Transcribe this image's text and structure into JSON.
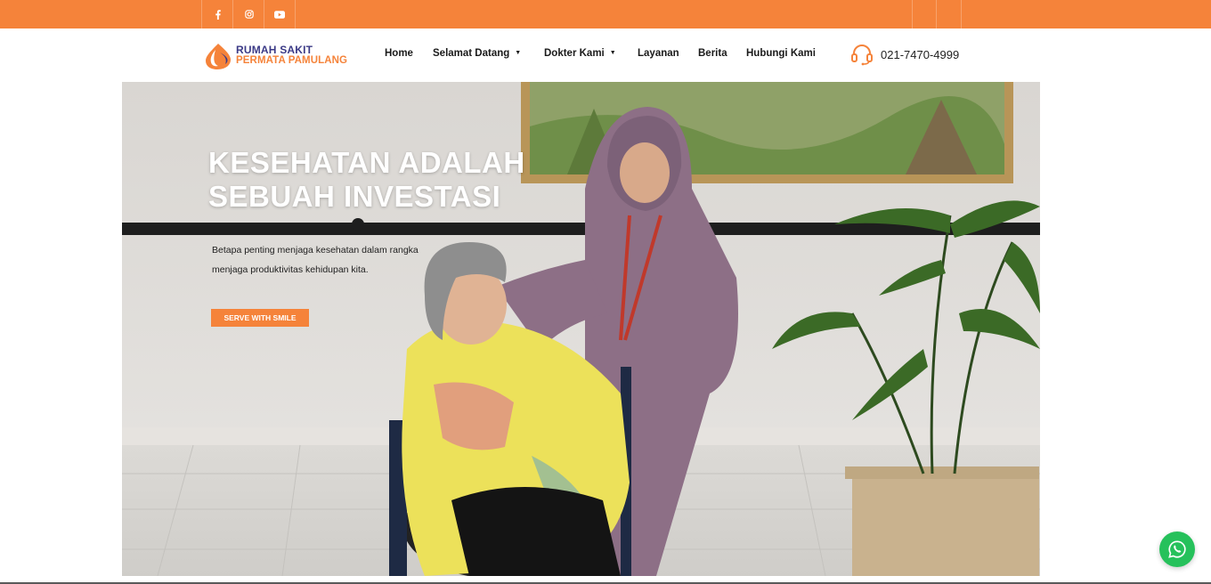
{
  "colors": {
    "accent": "#f5833a",
    "brand_navy": "#3b3a86",
    "whatsapp": "#26c15b"
  },
  "topbar": {
    "social_icons": [
      "facebook-icon",
      "instagram-icon",
      "youtube-icon"
    ]
  },
  "logo": {
    "line1": "RUMAH SAKIT",
    "line2": "PERMATA PAMULANG"
  },
  "nav": {
    "items": [
      {
        "label": "Home"
      },
      {
        "label": "Selamat Datang",
        "dropdown": true
      },
      {
        "label": "Dokter Kami",
        "dropdown": true
      },
      {
        "label": "Layanan"
      },
      {
        "label": "Berita"
      },
      {
        "label": "Hubungi Kami"
      }
    ],
    "phone": "021-7470-4999"
  },
  "hero": {
    "title_line1": "KESEHATAN ADALAH",
    "title_line2": "SEBUAH INVESTASI",
    "subtitle": "Betapa penting menjaga kesehatan dalam rangka menjaga produktivitas kehidupan kita.",
    "button": "SERVE WITH SMILE"
  },
  "float": {
    "icon": "whatsapp-icon"
  }
}
